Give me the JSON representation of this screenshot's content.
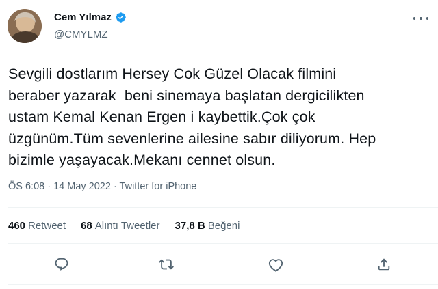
{
  "user": {
    "display_name": "Cem Yılmaz",
    "handle": "@CMYLMZ",
    "verified_color": "#1d9bf0"
  },
  "tweet": {
    "lines": [
      "Sevgili dostlarım Hersey Cok Güzel Olacak filmini",
      "beraber yazarak  beni sinemaya başlatan dergicilikten",
      "ustam Kemal Kenan Ergen i kaybettik.Çok çok",
      "üzgünüm.Tüm sevenlerine ailesine sabır diliyorum. Hep",
      "bizimle yaşayacak.Mekanı cennet olsun."
    ],
    "timestamp": "ÖS 6:08 · 14 May 2022 · ",
    "source": "Twitter for iPhone"
  },
  "stats": [
    {
      "value": "460",
      "label": "Retweet"
    },
    {
      "value": "68",
      "label": "Alıntı Tweetler"
    },
    {
      "value": "37,8 B",
      "label": "Beğeni"
    }
  ],
  "actions": [
    "reply-icon",
    "retweet-icon",
    "like-icon",
    "share-icon"
  ],
  "colors": {
    "text": "#0f1419",
    "secondary": "#536471",
    "divider": "#eff3f4"
  }
}
